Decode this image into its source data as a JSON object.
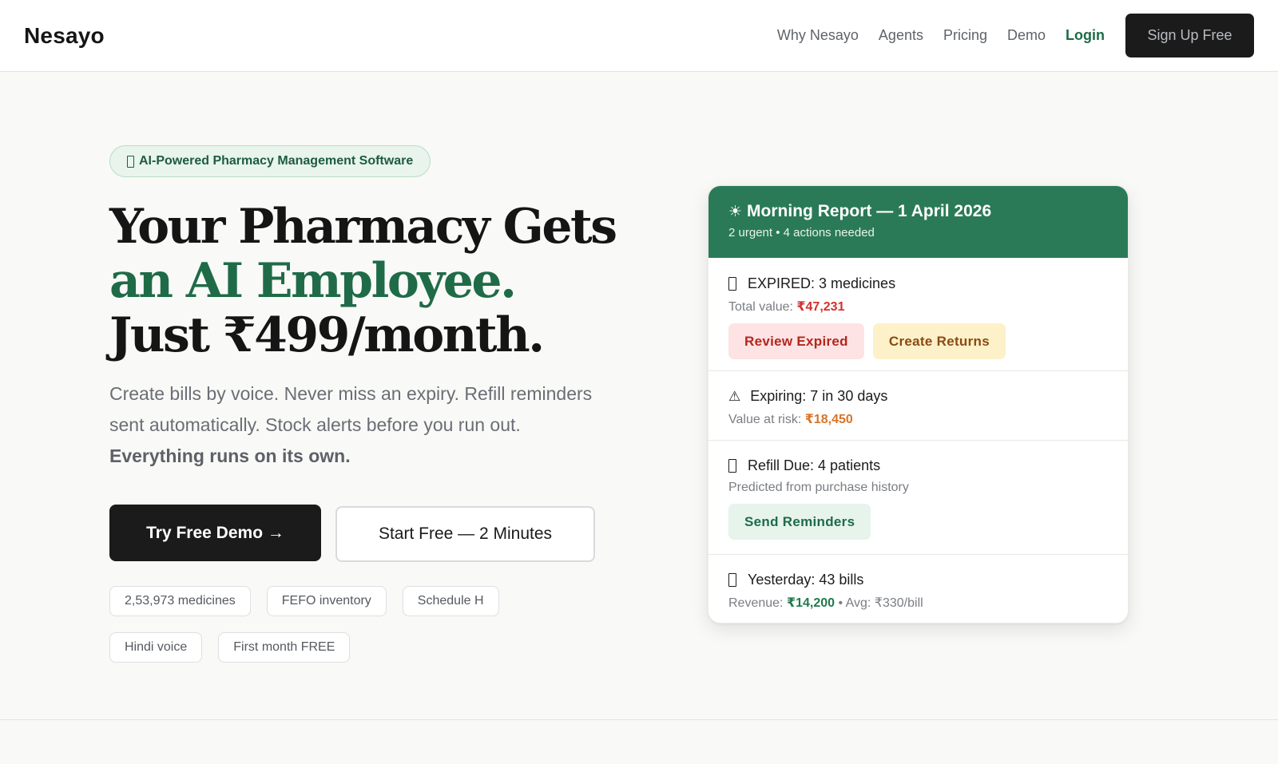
{
  "nav": {
    "logo": "Nesayo",
    "links": [
      "Why Nesayo",
      "Agents",
      "Pricing",
      "Demo"
    ],
    "login": "Login",
    "signup": "Sign Up Free"
  },
  "hero": {
    "badge": "AI-Powered Pharmacy Management Software",
    "headline_part1": "Your Pharmacy Gets ",
    "headline_accent": "an AI Employee.",
    "headline_part2": "Just ₹499/month.",
    "subhead": "Create bills by voice. Never miss an expiry. Refill reminders sent automatically. Stock alerts before you run out. ",
    "subhead_bold": "Everything runs on its own.",
    "primary_cta": "Try Free Demo →",
    "secondary_cta": "Start Free — 2 Minutes",
    "chips": [
      "2,53,973 medicines",
      "FEFO inventory",
      "Schedule H",
      "Hindi voice",
      "First month FREE"
    ]
  },
  "report": {
    "title": "Morning Report — 1 April 2026",
    "subtitle": "2 urgent • 4 actions needed",
    "expired": {
      "title": "EXPIRED: 3 medicines",
      "value_label": "Total value: ",
      "value": "₹47,231",
      "btn_review": "Review Expired",
      "btn_returns": "Create Returns"
    },
    "expiring": {
      "title": "Expiring: 7 in 30 days",
      "value_label": "Value at risk: ",
      "value": "₹18,450"
    },
    "refill": {
      "title": "Refill Due: 4 patients",
      "subtitle": "Predicted from purchase history",
      "btn_send": "Send Reminders"
    },
    "yesterday": {
      "title": "Yesterday: 43 bills",
      "revenue_label": "Revenue: ",
      "revenue": "₹14,200",
      "avg": " • Avg: ₹330/bill"
    }
  },
  "colors": {
    "accent_green": "#1f6b48",
    "card_header": "#2a7a57",
    "danger": "#d2312d",
    "warning": "#d9742a"
  },
  "icons": [
    "sun-icon",
    "warning-icon"
  ]
}
